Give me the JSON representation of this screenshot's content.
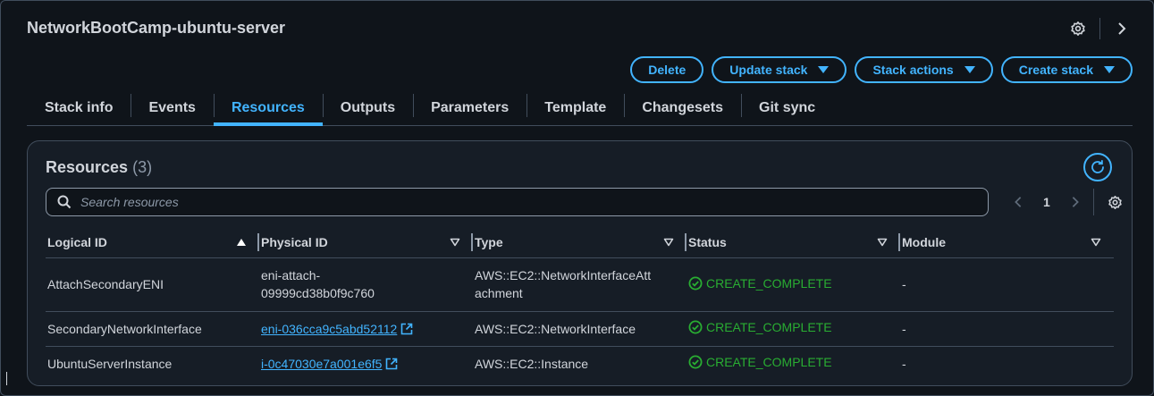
{
  "stack": {
    "name": "NetworkBootCamp-ubuntu-server"
  },
  "header": {
    "settings_icon": "gear-icon",
    "expand_icon": "chevron-right-icon"
  },
  "actions": {
    "delete": "Delete",
    "update_stack": "Update stack",
    "stack_actions": "Stack actions",
    "create_stack": "Create stack"
  },
  "tabs": [
    {
      "label": "Stack info"
    },
    {
      "label": "Events"
    },
    {
      "label": "Resources",
      "active": true
    },
    {
      "label": "Outputs"
    },
    {
      "label": "Parameters"
    },
    {
      "label": "Template"
    },
    {
      "label": "Changesets"
    },
    {
      "label": "Git sync"
    }
  ],
  "resources": {
    "title": "Resources",
    "count": "(3)",
    "search_placeholder": "Search resources",
    "page": "1",
    "columns": [
      "Logical ID",
      "Physical ID",
      "Type",
      "Status",
      "Module"
    ],
    "rows": [
      {
        "logical_id": "AttachSecondaryENI",
        "physical_id_line1": "eni-attach-",
        "physical_id_line2": "09999cd38b0f9c760",
        "type_line1": "AWS::EC2::NetworkInterfaceAtt",
        "type_line2": "achment",
        "status": "CREATE_COMPLETE",
        "module": "-"
      },
      {
        "logical_id": "SecondaryNetworkInterface",
        "physical_id": "eni-036cca9c5abd52112",
        "type": "AWS::EC2::NetworkInterface",
        "status": "CREATE_COMPLETE",
        "module": "-"
      },
      {
        "logical_id": "UbuntuServerInstance",
        "physical_id": "i-0c47030e7a001e6f5",
        "type": "AWS::EC2::Instance",
        "status": "CREATE_COMPLETE",
        "module": "-"
      }
    ]
  },
  "colors": {
    "accent": "#42b4ff",
    "success": "#29ad32",
    "background": "#0f141a",
    "border": "#414d5c"
  }
}
